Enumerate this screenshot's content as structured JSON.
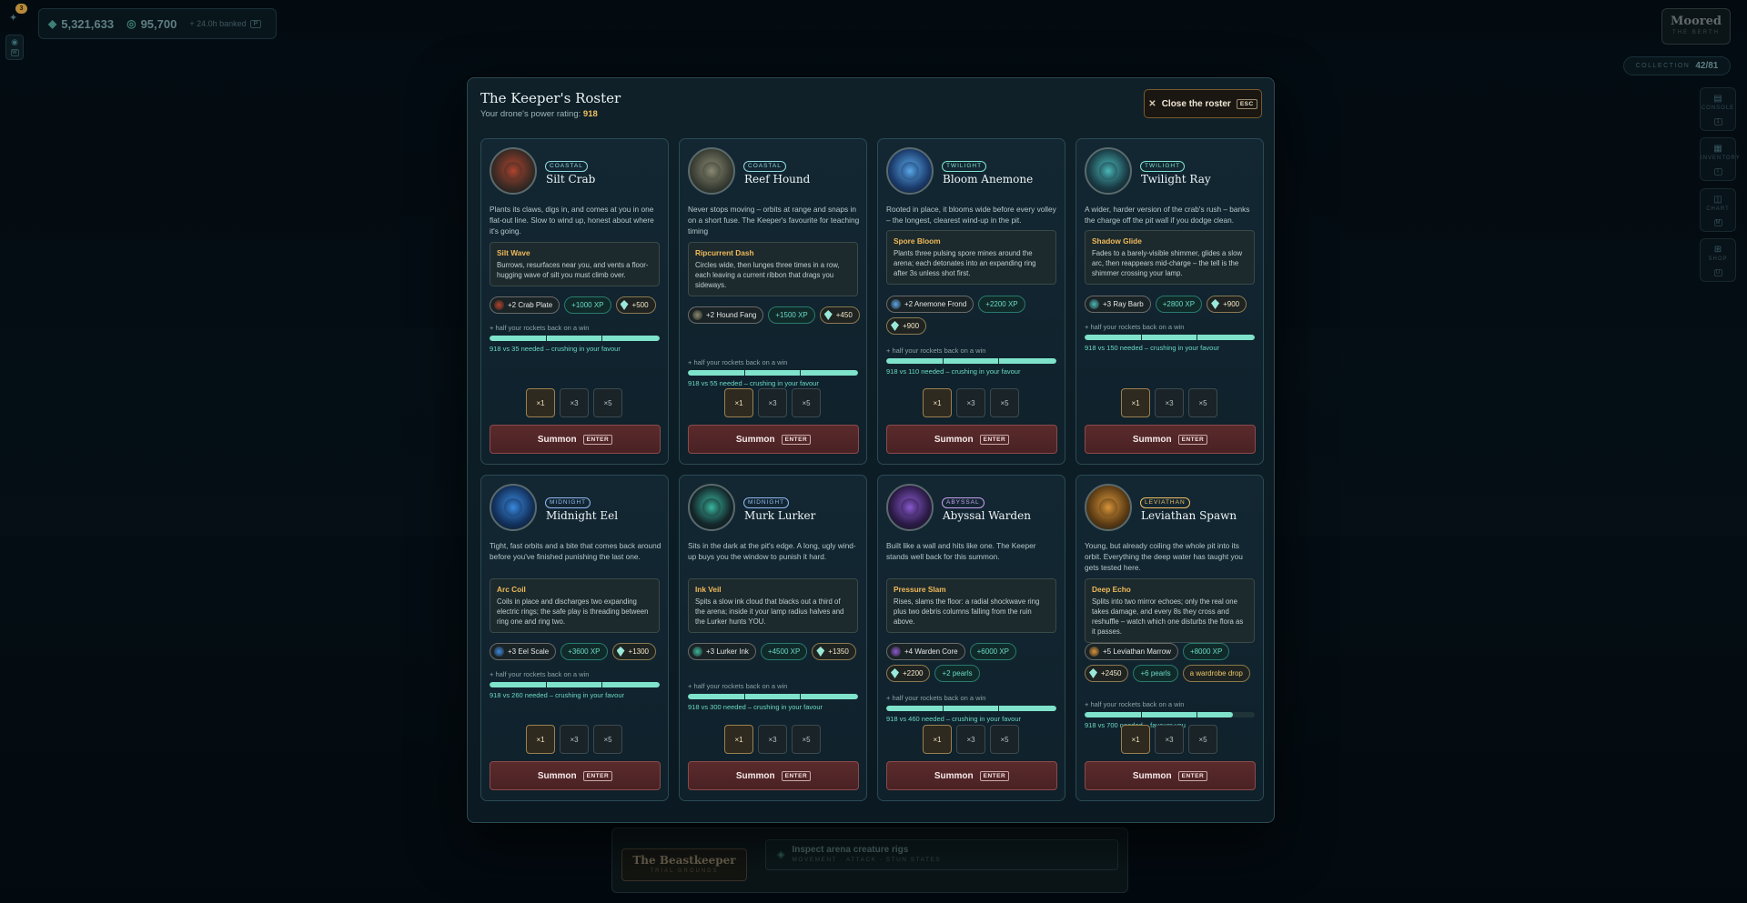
{
  "hud": {
    "notif_count": "3",
    "side_key": "W",
    "currency_gems": "5,321,633",
    "currency_coins": "95,700",
    "banked": "+ 24.0h banked",
    "banked_key": "P",
    "location_title": "Moored",
    "location_sub": "THE BERTH",
    "collection_label": "COLLECTION",
    "collection_value": "42/81",
    "menu": [
      {
        "label": "CONSOLE",
        "key": "1",
        "icon": "console-icon"
      },
      {
        "label": "INVENTORY",
        "key": "I",
        "icon": "inventory-icon"
      },
      {
        "label": "CHART",
        "key": "M",
        "icon": "chart-icon"
      },
      {
        "label": "SHOP",
        "key": "U",
        "icon": "shop-icon"
      }
    ]
  },
  "dock": {
    "title": "The Beastkeeper",
    "subtitle": "TRIAL GROUNDS",
    "inspect_title": "Inspect arena creature rigs",
    "inspect_sub": "MOVEMENT · ATTACK · STUN STATES"
  },
  "modal": {
    "title": "The Keeper's Roster",
    "power_label": "Your drone's power rating:",
    "power_value": "918",
    "close_label": "Close the roster",
    "close_key": "ESC",
    "half_rockets": "+ half your rockets back on a win",
    "mult_options": [
      "×1",
      "×3",
      "×5"
    ],
    "summon_label": "Summon",
    "summon_key": "ENTER"
  },
  "creatures": [
    {
      "tag": "COASTAL",
      "tag_color": "#8fd8e0",
      "name": "Silt Crab",
      "colors": [
        "#3a2a24",
        "#b0442e"
      ],
      "desc": "Plants its claws, digs in, and comes at you in one flat-out line. Slow to wind up, honest about where it's going.",
      "ability_name": "Silt Wave",
      "ability_desc": "Burrows, resurfaces near you, and vents a floor-hugging wave of silt you must climb over.",
      "item": "+2 Crab Plate",
      "xp": "+1000 XP",
      "gems": "+500",
      "extra": [],
      "progress": 1.0,
      "need": "918 vs 35 needed – crushing in your favour"
    },
    {
      "tag": "COASTAL",
      "tag_color": "#8fd8e0",
      "name": "Reef Hound",
      "colors": [
        "#3a3e34",
        "#8a8a72"
      ],
      "desc": "Never stops moving – orbits at range and snaps in on a short fuse. The Keeper's favourite for teaching timing",
      "ability_name": "Ripcurrent Dash",
      "ability_desc": "Circles wide, then lunges three times in a row, each leaving a current ribbon that drags you sideways.",
      "item": "+2 Hound Fang",
      "xp": "+1500 XP",
      "gems": "+450",
      "extra": [],
      "progress": 1.0,
      "need": "918 vs 55 needed – crushing in your favour"
    },
    {
      "tag": "TWILIGHT",
      "tag_color": "#7fe3cc",
      "name": "Bloom Anemone",
      "colors": [
        "#1a3a6a",
        "#5aa8e8"
      ],
      "desc": "Rooted in place, it blooms wide before every volley – the longest, clearest wind-up in the pit.",
      "ability_name": "Spore Bloom",
      "ability_desc": "Plants three pulsing spore mines around the arena; each detonates into an expanding ring after 3s unless shot first.",
      "item": "+2 Anemone Frond",
      "xp": "+2200 XP",
      "gems": "+900",
      "extra": [],
      "progress": 1.0,
      "need": "918 vs 110 needed – crushing in your favour"
    },
    {
      "tag": "TWILIGHT",
      "tag_color": "#7fe3cc",
      "name": "Twilight Ray",
      "colors": [
        "#1a3a44",
        "#4ab8b8"
      ],
      "desc": "A wider, harder version of the crab's rush – banks the charge off the pit wall if you dodge clean.",
      "ability_name": "Shadow Glide",
      "ability_desc": "Fades to a barely-visible shimmer, glides a slow arc, then reappears mid-charge – the tell is the shimmer crossing your lamp.",
      "item": "+3 Ray Barb",
      "xp": "+2800 XP",
      "gems": "+900",
      "extra": [],
      "progress": 1.0,
      "need": "918 vs 150 needed – crushing in your favour"
    },
    {
      "tag": "MIDNIGHT",
      "tag_color": "#8fb8f0",
      "name": "Midnight Eel",
      "colors": [
        "#12305a",
        "#3a8ae0"
      ],
      "desc": "Tight, fast orbits and a bite that comes back around before you've finished punishing the last one.",
      "ability_name": "Arc Coil",
      "ability_desc": "Coils in place and discharges two expanding electric rings; the safe play is threading between ring one and ring two.",
      "item": "+3 Eel Scale",
      "xp": "+3600 XP",
      "gems": "+1300",
      "extra": [],
      "progress": 1.0,
      "need": "918 vs 260 needed – crushing in your favour"
    },
    {
      "tag": "MIDNIGHT",
      "tag_color": "#8fb8f0",
      "name": "Murk Lurker",
      "colors": [
        "#14262a",
        "#3ab8a0"
      ],
      "desc": "Sits in the dark at the pit's edge. A long, ugly wind-up buys you the window to punish it hard.",
      "ability_name": "Ink Veil",
      "ability_desc": "Spits a slow ink cloud that blacks out a third of the arena; inside it your lamp radius halves and the Lurker hunts YOU.",
      "item": "+3 Lurker Ink",
      "xp": "+4500 XP",
      "gems": "+1350",
      "extra": [],
      "progress": 1.0,
      "need": "918 vs 300 needed – crushing in your favour"
    },
    {
      "tag": "ABYSSAL",
      "tag_color": "#c8a0f0",
      "name": "Abyssal Warden",
      "colors": [
        "#2a1a44",
        "#8a5ad0"
      ],
      "desc": "Built like a wall and hits like one. The Keeper stands well back for this summon.",
      "ability_name": "Pressure Slam",
      "ability_desc": "Rises, slams the floor: a radial shockwave ring plus two debris columns falling from the ruin above.",
      "item": "+4 Warden Core",
      "xp": "+6000 XP",
      "gems": "+2200",
      "extra": [
        "+2 pearls"
      ],
      "progress": 1.0,
      "need": "918 vs 460 needed – crushing in your favour"
    },
    {
      "tag": "LEVIATHAN",
      "tag_color": "#f0c060",
      "name": "Leviathan Spawn",
      "colors": [
        "#5a3a14",
        "#d8963a"
      ],
      "desc": "Young, but already coiling the whole pit into its orbit. Everything the deep water has taught you gets tested here.",
      "ability_name": "Deep Echo",
      "ability_desc": "Splits into two mirror echoes; only the real one takes damage, and every 8s they cross and reshuffle – watch which one disturbs the flora as it passes.",
      "item": "+5 Leviathan Marrow",
      "xp": "+8000 XP",
      "gems": "+2450",
      "extra": [
        "+6 pearls",
        "a wardrobe drop"
      ],
      "progress": 0.87,
      "need": "918 vs 700 needed – favours you"
    }
  ]
}
